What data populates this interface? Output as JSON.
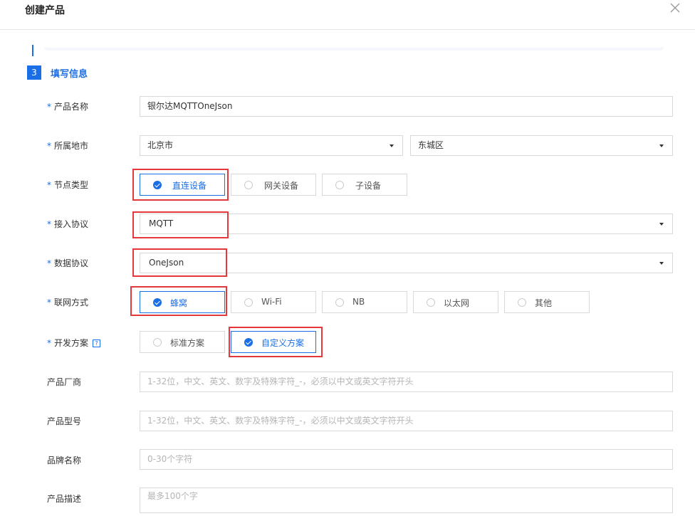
{
  "dialog": {
    "title": "创建产品"
  },
  "step": {
    "number": "3",
    "title": "填写信息"
  },
  "fields": {
    "product_name": {
      "label": "产品名称",
      "value": "银尔达MQTTOneJson"
    },
    "region": {
      "label": "所属地市",
      "city": "北京市",
      "district": "东城区"
    },
    "node_type": {
      "label": "节点类型",
      "options": [
        "直连设备",
        "网关设备",
        "子设备"
      ],
      "selected": "直连设备"
    },
    "access_protocol": {
      "label": "接入协议",
      "value": "MQTT"
    },
    "data_protocol": {
      "label": "数据协议",
      "value": "OneJson"
    },
    "network": {
      "label": "联网方式",
      "options": [
        "蜂窝",
        "Wi-Fi",
        "NB",
        "以太网",
        "其他"
      ],
      "selected": "蜂窝"
    },
    "dev_plan": {
      "label": "开发方案",
      "help": "?",
      "options": [
        "标准方案",
        "自定义方案"
      ],
      "selected": "自定义方案"
    },
    "manufacturer": {
      "label": "产品厂商",
      "placeholder": "1-32位，中文、英文、数字及特殊字符_-，必须以中文或英文字符开头"
    },
    "model": {
      "label": "产品型号",
      "placeholder": "1-32位，中文、英文、数字及特殊字符_-，必须以中文或英文字符开头"
    },
    "brand": {
      "label": "品牌名称",
      "placeholder": "0-30个字符"
    },
    "description": {
      "label": "产品描述",
      "placeholder": "最多100个字"
    }
  },
  "required_mark": "*",
  "colors": {
    "accent": "#1a6ee6",
    "highlight": "#e4393c",
    "border": "#d9d9d9"
  }
}
